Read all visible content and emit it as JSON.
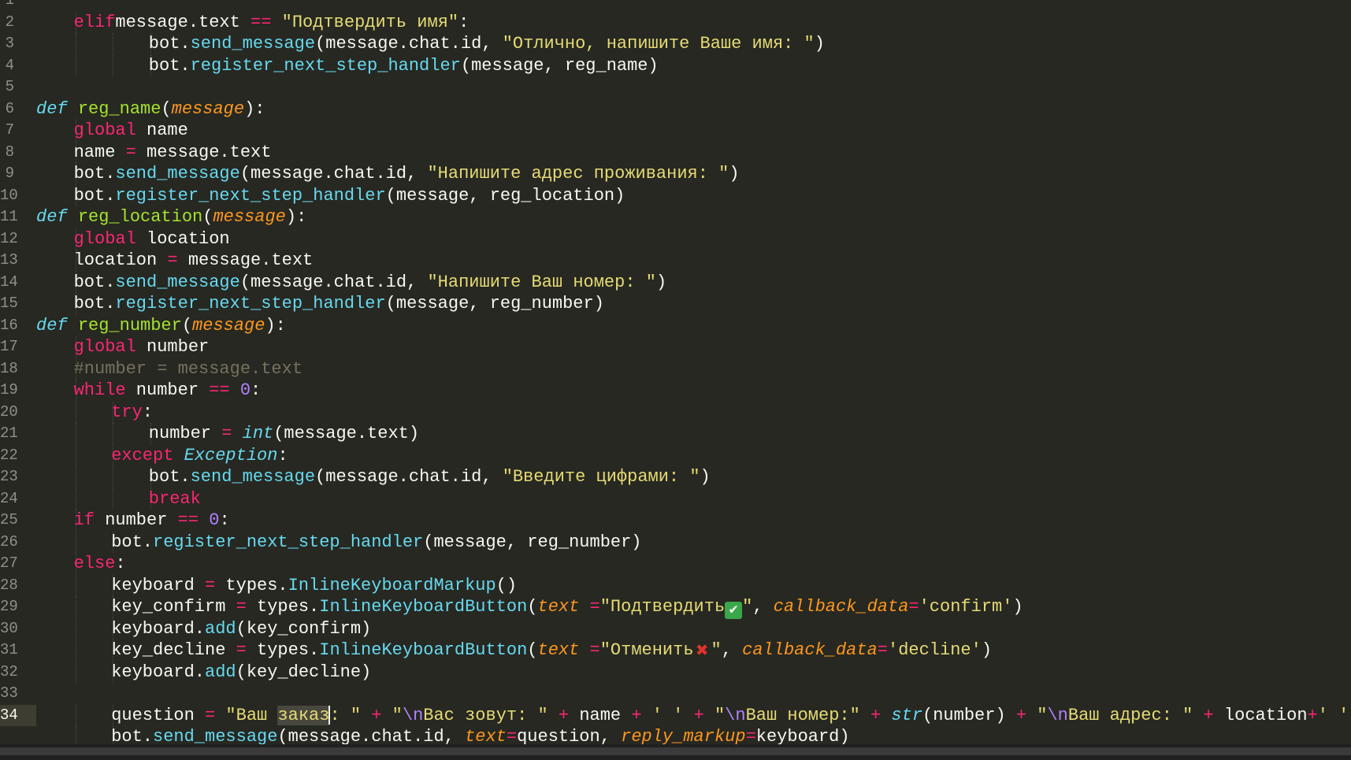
{
  "editor": {
    "line_numbers": [
      "1",
      "2",
      "3",
      "4",
      "5",
      "6",
      "7",
      "8",
      "9",
      "10",
      "11",
      "12",
      "13",
      "14",
      "15",
      "16",
      "17",
      "18",
      "19",
      "20",
      "21",
      "22",
      "23",
      "24",
      "25",
      "26",
      "27",
      "28",
      "29",
      "30",
      "31",
      "32",
      "33",
      "34"
    ],
    "active_line": "34",
    "lines": [
      {
        "tokens": []
      },
      {
        "indent": 1,
        "tokens": [
          [
            "kw",
            "elif"
          ],
          [
            "",
            "message.text "
          ],
          [
            "op",
            "=="
          ],
          [
            "",
            " "
          ],
          [
            "str",
            "\"Подтвердить имя\""
          ],
          [
            "",
            ":"
          ]
        ]
      },
      {
        "indent": 3,
        "tokens": [
          [
            "",
            "bot."
          ],
          [
            "attr",
            "send_message"
          ],
          [
            "",
            "(message.chat.id, "
          ],
          [
            "str",
            "\"Отлично, напишите Ваше имя: \""
          ],
          [
            "",
            ")"
          ]
        ]
      },
      {
        "indent": 3,
        "tokens": [
          [
            "",
            "bot."
          ],
          [
            "attr",
            "register_next_step_handler"
          ],
          [
            "",
            "(message, reg_name)"
          ]
        ]
      },
      {
        "tokens": []
      },
      {
        "indent": 0,
        "tokens": [
          [
            "def",
            "def"
          ],
          [
            "",
            " "
          ],
          [
            "fn",
            "reg_name"
          ],
          [
            "",
            "("
          ],
          [
            "param",
            "message"
          ],
          [
            "",
            "):"
          ]
        ]
      },
      {
        "indent": 1,
        "tokens": [
          [
            "kw",
            "global"
          ],
          [
            "",
            " name"
          ]
        ]
      },
      {
        "indent": 1,
        "tokens": [
          [
            "",
            "name "
          ],
          [
            "op",
            "="
          ],
          [
            "",
            " message.text"
          ]
        ]
      },
      {
        "indent": 1,
        "tokens": [
          [
            "",
            "bot."
          ],
          [
            "attr",
            "send_message"
          ],
          [
            "",
            "(message.chat.id, "
          ],
          [
            "str",
            "\"Напишите адрес проживания: \""
          ],
          [
            "",
            ")"
          ]
        ]
      },
      {
        "indent": 1,
        "tokens": [
          [
            "",
            "bot."
          ],
          [
            "attr",
            "register_next_step_handler"
          ],
          [
            "",
            "(message, reg_location)"
          ]
        ]
      },
      {
        "indent": 0,
        "tokens": [
          [
            "def",
            "def"
          ],
          [
            "",
            " "
          ],
          [
            "fn",
            "reg_location"
          ],
          [
            "",
            "("
          ],
          [
            "param",
            "message"
          ],
          [
            "",
            "):"
          ]
        ]
      },
      {
        "indent": 1,
        "tokens": [
          [
            "kw",
            "global"
          ],
          [
            "",
            " location"
          ]
        ]
      },
      {
        "indent": 1,
        "tokens": [
          [
            "",
            "location "
          ],
          [
            "op",
            "="
          ],
          [
            "",
            " message.text"
          ]
        ]
      },
      {
        "indent": 1,
        "tokens": [
          [
            "",
            "bot."
          ],
          [
            "attr",
            "send_message"
          ],
          [
            "",
            "(message.chat.id, "
          ],
          [
            "str",
            "\"Напишите Ваш номер: \""
          ],
          [
            "",
            ")"
          ]
        ]
      },
      {
        "indent": 1,
        "tokens": [
          [
            "",
            "bot."
          ],
          [
            "attr",
            "register_next_step_handler"
          ],
          [
            "",
            "(message, reg_number)"
          ]
        ]
      },
      {
        "indent": 0,
        "tokens": [
          [
            "def",
            "def"
          ],
          [
            "",
            " "
          ],
          [
            "fn",
            "reg_number"
          ],
          [
            "",
            "("
          ],
          [
            "param",
            "message"
          ],
          [
            "",
            "):"
          ]
        ]
      },
      {
        "indent": 1,
        "tokens": [
          [
            "kw",
            "global"
          ],
          [
            "",
            " number"
          ]
        ]
      },
      {
        "indent": 1,
        "tokens": [
          [
            "cmt",
            "#number = message.text"
          ]
        ]
      },
      {
        "indent": 1,
        "tokens": [
          [
            "kw",
            "while"
          ],
          [
            "",
            " number "
          ],
          [
            "op",
            "=="
          ],
          [
            "",
            " "
          ],
          [
            "num",
            "0"
          ],
          [
            "",
            ":"
          ]
        ]
      },
      {
        "indent": 2,
        "tokens": [
          [
            "kw",
            "try"
          ],
          [
            "",
            ":"
          ]
        ]
      },
      {
        "indent": 3,
        "tokens": [
          [
            "",
            "number "
          ],
          [
            "op",
            "="
          ],
          [
            "",
            " "
          ],
          [
            "builtin",
            "int"
          ],
          [
            "",
            "(message.text)"
          ]
        ]
      },
      {
        "indent": 2,
        "tokens": [
          [
            "kw",
            "except"
          ],
          [
            "",
            " "
          ],
          [
            "builtin",
            "Exception"
          ],
          [
            "",
            ":"
          ]
        ]
      },
      {
        "indent": 3,
        "tokens": [
          [
            "",
            "bot."
          ],
          [
            "attr",
            "send_message"
          ],
          [
            "",
            "(message.chat.id, "
          ],
          [
            "str",
            "\"Введите цифрами: \""
          ],
          [
            "",
            ")"
          ]
        ]
      },
      {
        "indent": 3,
        "tokens": [
          [
            "kw",
            "break"
          ]
        ]
      },
      {
        "indent": 1,
        "tokens": [
          [
            "kw",
            "if"
          ],
          [
            "",
            " number "
          ],
          [
            "op",
            "=="
          ],
          [
            "",
            " "
          ],
          [
            "num",
            "0"
          ],
          [
            "",
            ":"
          ]
        ]
      },
      {
        "indent": 2,
        "tokens": [
          [
            "",
            "bot."
          ],
          [
            "attr",
            "register_next_step_handler"
          ],
          [
            "",
            "(message, reg_number)"
          ]
        ]
      },
      {
        "indent": 1,
        "tokens": [
          [
            "kw",
            "else"
          ],
          [
            "",
            ":"
          ]
        ]
      },
      {
        "indent": 2,
        "tokens": [
          [
            "",
            "keyboard "
          ],
          [
            "op",
            "="
          ],
          [
            "",
            " types."
          ],
          [
            "attr",
            "InlineKeyboardMarkup"
          ],
          [
            "",
            "()"
          ]
        ]
      },
      {
        "indent": 2,
        "tokens": [
          [
            "",
            "key_confirm "
          ],
          [
            "op",
            "="
          ],
          [
            "",
            " types."
          ],
          [
            "attr",
            "InlineKeyboardButton"
          ],
          [
            "",
            "("
          ],
          [
            "param",
            "text"
          ],
          [
            "",
            " "
          ],
          [
            "op",
            "="
          ],
          [
            "str",
            "\"Подтвердить"
          ],
          [
            "check",
            "✔"
          ],
          [
            "str",
            "\""
          ],
          [
            "",
            ", "
          ],
          [
            "param",
            "callback_data"
          ],
          [
            "op",
            "="
          ],
          [
            "str",
            "'confirm'"
          ],
          [
            "",
            ")"
          ]
        ]
      },
      {
        "indent": 2,
        "tokens": [
          [
            "",
            "keyboard."
          ],
          [
            "attr",
            "add"
          ],
          [
            "",
            "(key_confirm)"
          ]
        ]
      },
      {
        "indent": 2,
        "tokens": [
          [
            "",
            "key_decline "
          ],
          [
            "op",
            "="
          ],
          [
            "",
            " types."
          ],
          [
            "attr",
            "InlineKeyboardButton"
          ],
          [
            "",
            "("
          ],
          [
            "param",
            "text"
          ],
          [
            "",
            " "
          ],
          [
            "op",
            "="
          ],
          [
            "str",
            "\"Отменить"
          ],
          [
            "xmark",
            "✖"
          ],
          [
            "str",
            "\""
          ],
          [
            "",
            ", "
          ],
          [
            "param",
            "callback_data"
          ],
          [
            "op",
            "="
          ],
          [
            "str",
            "'decline'"
          ],
          [
            "",
            ")"
          ]
        ]
      },
      {
        "indent": 2,
        "tokens": [
          [
            "",
            "keyboard."
          ],
          [
            "attr",
            "add"
          ],
          [
            "",
            "(key_decline)"
          ]
        ]
      },
      {
        "tokens": []
      },
      {
        "indent": 2,
        "tokens": [
          [
            "",
            "question "
          ],
          [
            "op",
            "="
          ],
          [
            "",
            " "
          ],
          [
            "str",
            "\"Ваш "
          ],
          [
            "strhl",
            "заказ"
          ],
          [
            "cursor",
            ""
          ],
          [
            "str",
            ": \""
          ],
          [
            "",
            " "
          ],
          [
            "op",
            "+"
          ],
          [
            "",
            " "
          ],
          [
            "str",
            "\""
          ],
          [
            "esc",
            "\\n"
          ],
          [
            "str",
            "Вас зовут: \""
          ],
          [
            "",
            " "
          ],
          [
            "op",
            "+"
          ],
          [
            "",
            " name "
          ],
          [
            "op",
            "+"
          ],
          [
            "",
            " "
          ],
          [
            "str",
            "' '"
          ],
          [
            "",
            " "
          ],
          [
            "op",
            "+"
          ],
          [
            "",
            " "
          ],
          [
            "str",
            "\""
          ],
          [
            "esc",
            "\\n"
          ],
          [
            "str",
            "Ваш номер:\""
          ],
          [
            "",
            " "
          ],
          [
            "op",
            "+"
          ],
          [
            "",
            " "
          ],
          [
            "builtin",
            "str"
          ],
          [
            "",
            "(number) "
          ],
          [
            "op",
            "+"
          ],
          [
            "",
            " "
          ],
          [
            "str",
            "\""
          ],
          [
            "esc",
            "\\n"
          ],
          [
            "str",
            "Ваш адрес: \""
          ],
          [
            "",
            " "
          ],
          [
            "op",
            "+"
          ],
          [
            "",
            " location"
          ],
          [
            "op",
            "+"
          ],
          [
            "str",
            "' '"
          ]
        ]
      }
    ],
    "partial_line": {
      "indent": 2,
      "tokens": [
        [
          "",
          "bot."
        ],
        [
          "attr",
          "send_message"
        ],
        [
          "",
          "(message.chat.id, "
        ],
        [
          "param",
          "text"
        ],
        [
          "op",
          "="
        ],
        [
          "",
          "question, "
        ],
        [
          "param",
          "reply_markup"
        ],
        [
          "op",
          "="
        ],
        [
          "",
          "keyboard)"
        ]
      ]
    }
  }
}
